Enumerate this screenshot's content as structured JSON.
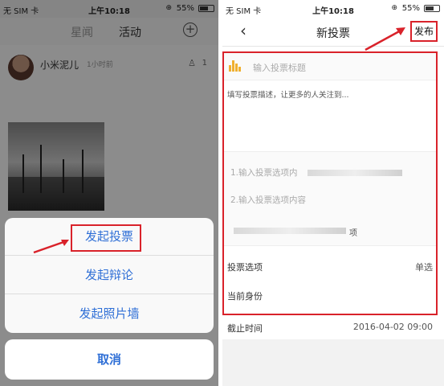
{
  "left": {
    "status": {
      "carrier": "无 SIM 卡 ",
      "time": "上午10:18",
      "battery": "55%"
    },
    "nav": {
      "tab_stars": "星闻",
      "tab_activity": "活动"
    },
    "post": {
      "username": "小米泥儿",
      "time": "1小时前",
      "count": "1"
    },
    "sheet": {
      "vote": "发起投票",
      "debate": "发起辩论",
      "photo_wall": "发起照片墙",
      "cancel": "取消"
    }
  },
  "right": {
    "status": {
      "carrier": "无 SIM 卡 ",
      "time": "上午10:18",
      "battery": "55%"
    },
    "nav": {
      "back": "‹",
      "title": "新投票",
      "publish": "发布"
    },
    "form": {
      "title_placeholder": "输入投票标题",
      "description": "填写投票描述，让更多的人关注到...",
      "option1": "1.输入投票选项内",
      "option2": "2.输入投票选项内容",
      "option_more_suffix": "项",
      "vote_option_label": "投票选项",
      "vote_option_value": "单选",
      "identity_label": "当前身份",
      "deadline_label": "截止时间",
      "deadline_value": "2016-04-02 09:00"
    }
  },
  "colors": {
    "accent_red": "#d9222a",
    "link_blue": "#2f6fd6",
    "chart_yellow": "#f0b030"
  }
}
